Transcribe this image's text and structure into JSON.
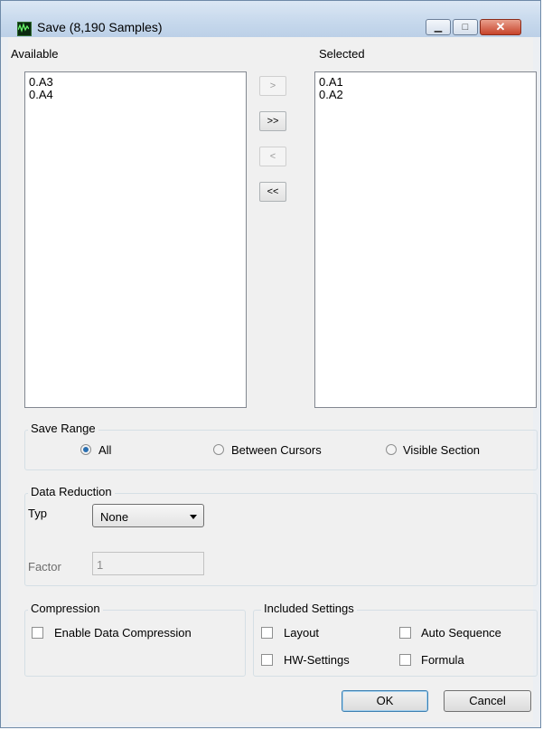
{
  "window": {
    "title": "Save (8,190 Samples)",
    "icon": "scope-app-icon",
    "controls": {
      "minimize": "▁",
      "maximize": "□",
      "close": "✕"
    }
  },
  "available": {
    "label": "Available",
    "items": [
      "0.A3",
      "0.A4"
    ]
  },
  "selected": {
    "label": "Selected",
    "items": [
      "0.A1",
      "0.A2"
    ]
  },
  "move_buttons": {
    "add_one": ">",
    "add_all": ">>",
    "remove_one": "<",
    "remove_all": "<<"
  },
  "save_range": {
    "title": "Save Range",
    "options": [
      "All",
      "Between Cursors",
      "Visible Section"
    ],
    "selected": "All"
  },
  "data_reduction": {
    "title": "Data Reduction",
    "type_label": "Typ",
    "type_value": "None",
    "factor_label": "Factor",
    "factor_value": "1"
  },
  "compression": {
    "title": "Compression",
    "enable_label": "Enable Data Compression",
    "enabled": false
  },
  "included_settings": {
    "title": "Included Settings",
    "layout": "Layout",
    "auto_sequence": "Auto Sequence",
    "hw_settings": "HW-Settings",
    "formula": "Formula"
  },
  "buttons": {
    "ok": "OK",
    "cancel": "Cancel"
  }
}
